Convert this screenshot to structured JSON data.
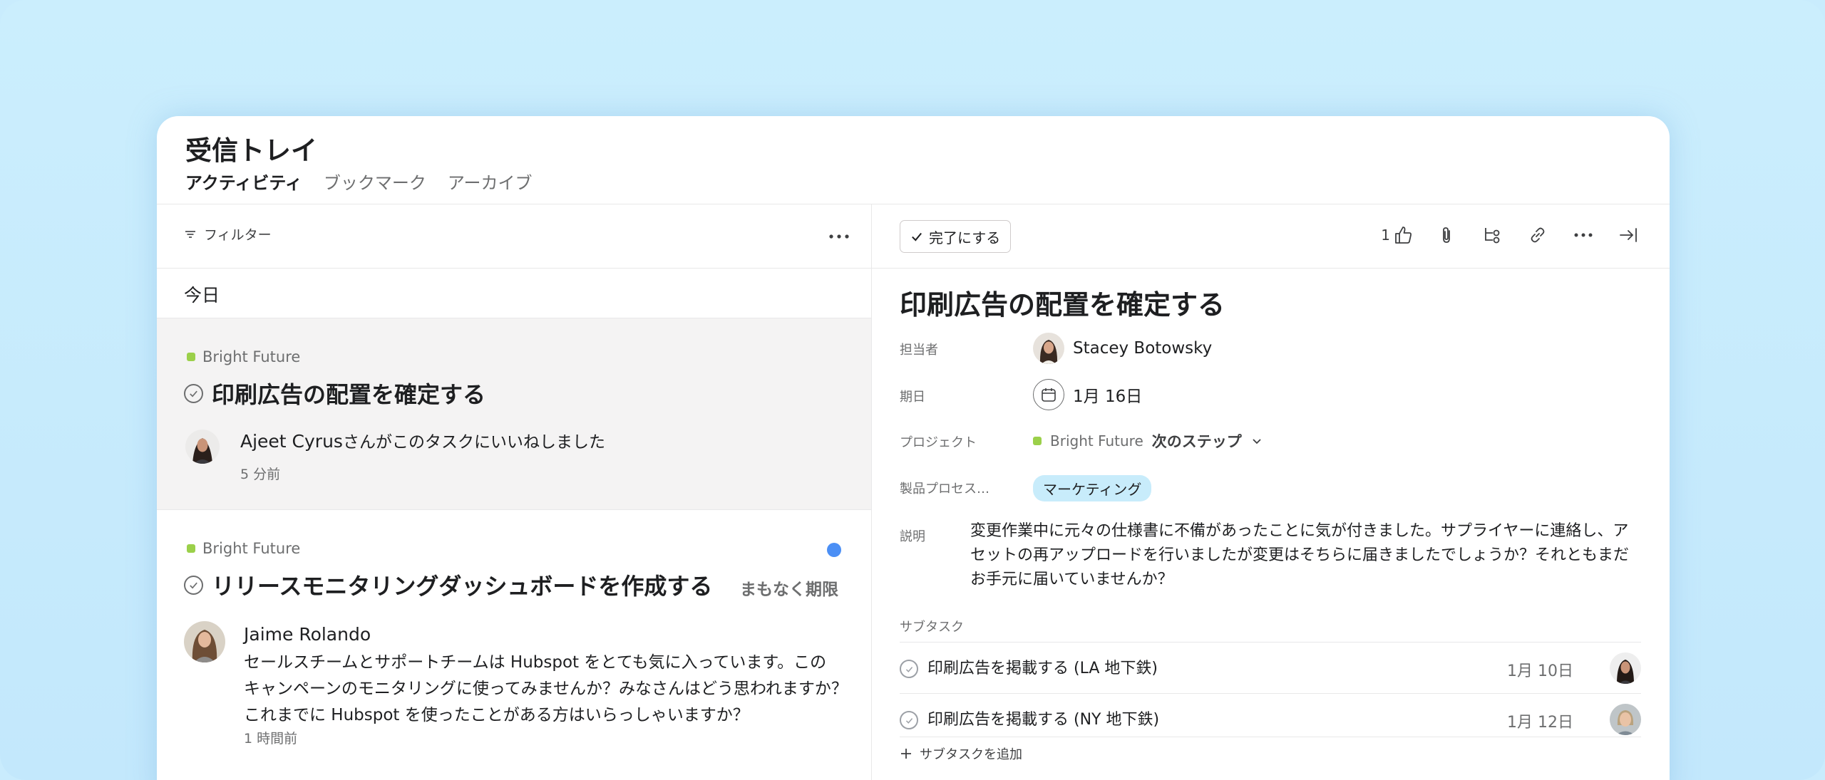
{
  "header": {
    "title": "受信トレイ",
    "tabs": [
      {
        "label": "アクティビティ",
        "active": true
      },
      {
        "label": "ブックマーク",
        "active": false
      },
      {
        "label": "アーカイブ",
        "active": false
      }
    ]
  },
  "left": {
    "filter_label": "フィルター",
    "more_icon": "more-horizontal-icon",
    "section_label": "今日",
    "cards": [
      {
        "project": "Bright Future",
        "project_color": "#9bd04a",
        "title": "印刷広告の配置を確定する",
        "actor": "Ajeet Cyrus",
        "action": "さんがこのタスクにいいねしました",
        "time": "5 分前"
      },
      {
        "project": "Bright Future",
        "project_color": "#9bd04a",
        "title": "リリースモニタリングダッシュボードを作成する",
        "badge": "まもなく期限",
        "unread": true,
        "actor": "Jaime Rolando",
        "message_lines": [
          "セールスチームとサポートチームは Hubspot をとても気に入っています。この",
          "キャンペーンのモニタリングに使ってみませんか？みなさんはどう思われますか？",
          "これまでに Hubspot を使ったことがある方はいらっしゃいますか？"
        ],
        "time": "1 時間前"
      }
    ]
  },
  "right": {
    "complete_label": "完了にする",
    "like_count": "1",
    "title": "印刷広告の配置を確定する",
    "fields": {
      "assignee_label": "担当者",
      "assignee": "Stacey Botowsky",
      "due_label": "期日",
      "due": "1月 16日",
      "project_label": "プロジェクト",
      "project_name": "Bright Future",
      "project_section": "次のステップ",
      "process_label": "製品プロセス…",
      "process_tag": "マーケティング"
    },
    "description_label": "説明",
    "description_lines": [
      "変更作業中に元々の仕様書に不備があったことに気が付きました。サプライヤーに連絡し、ア",
      "セットの再アップロードを行いましたが変更はそちらに届きましたでしょうか？それともまだ",
      "お手元に届いていませんか？"
    ],
    "subtasks_label": "サブタスク",
    "subtasks": [
      {
        "name": "印刷広告を掲載する (LA 地下鉄)",
        "date": "1月 10日"
      },
      {
        "name": "印刷広告を掲載する (NY 地下鉄)",
        "date": "1月 12日"
      }
    ],
    "add_subtask_label": "サブタスクを追加"
  },
  "colors": {
    "background": "#c9ecfd",
    "card_selected": "#f4f3f3",
    "unread_dot": "#4b8ff5",
    "tag_bg": "#c8ecfb"
  }
}
